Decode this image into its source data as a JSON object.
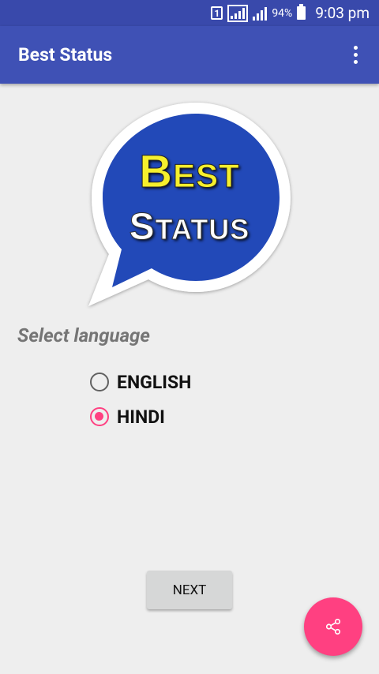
{
  "status_bar": {
    "sim": "1",
    "battery_percent": "94%",
    "time": "9:03 pm"
  },
  "app_bar": {
    "title": "Best Status",
    "overflow_icon": "more-vert-icon"
  },
  "logo": {
    "line1_initial": "B",
    "line1_rest": "EST",
    "line2_initial": "S",
    "line2_rest": "TATUS"
  },
  "language": {
    "label": "Select language",
    "options": [
      {
        "label": "ENGLISH",
        "checked": false
      },
      {
        "label": "HINDI",
        "checked": true
      }
    ]
  },
  "actions": {
    "next_label": "NEXT",
    "fab_icon": "share-icon"
  },
  "colors": {
    "primary": "#3f51b5",
    "primary_dark": "#3949ab",
    "accent": "#ff4081",
    "background": "#eeeeee"
  }
}
